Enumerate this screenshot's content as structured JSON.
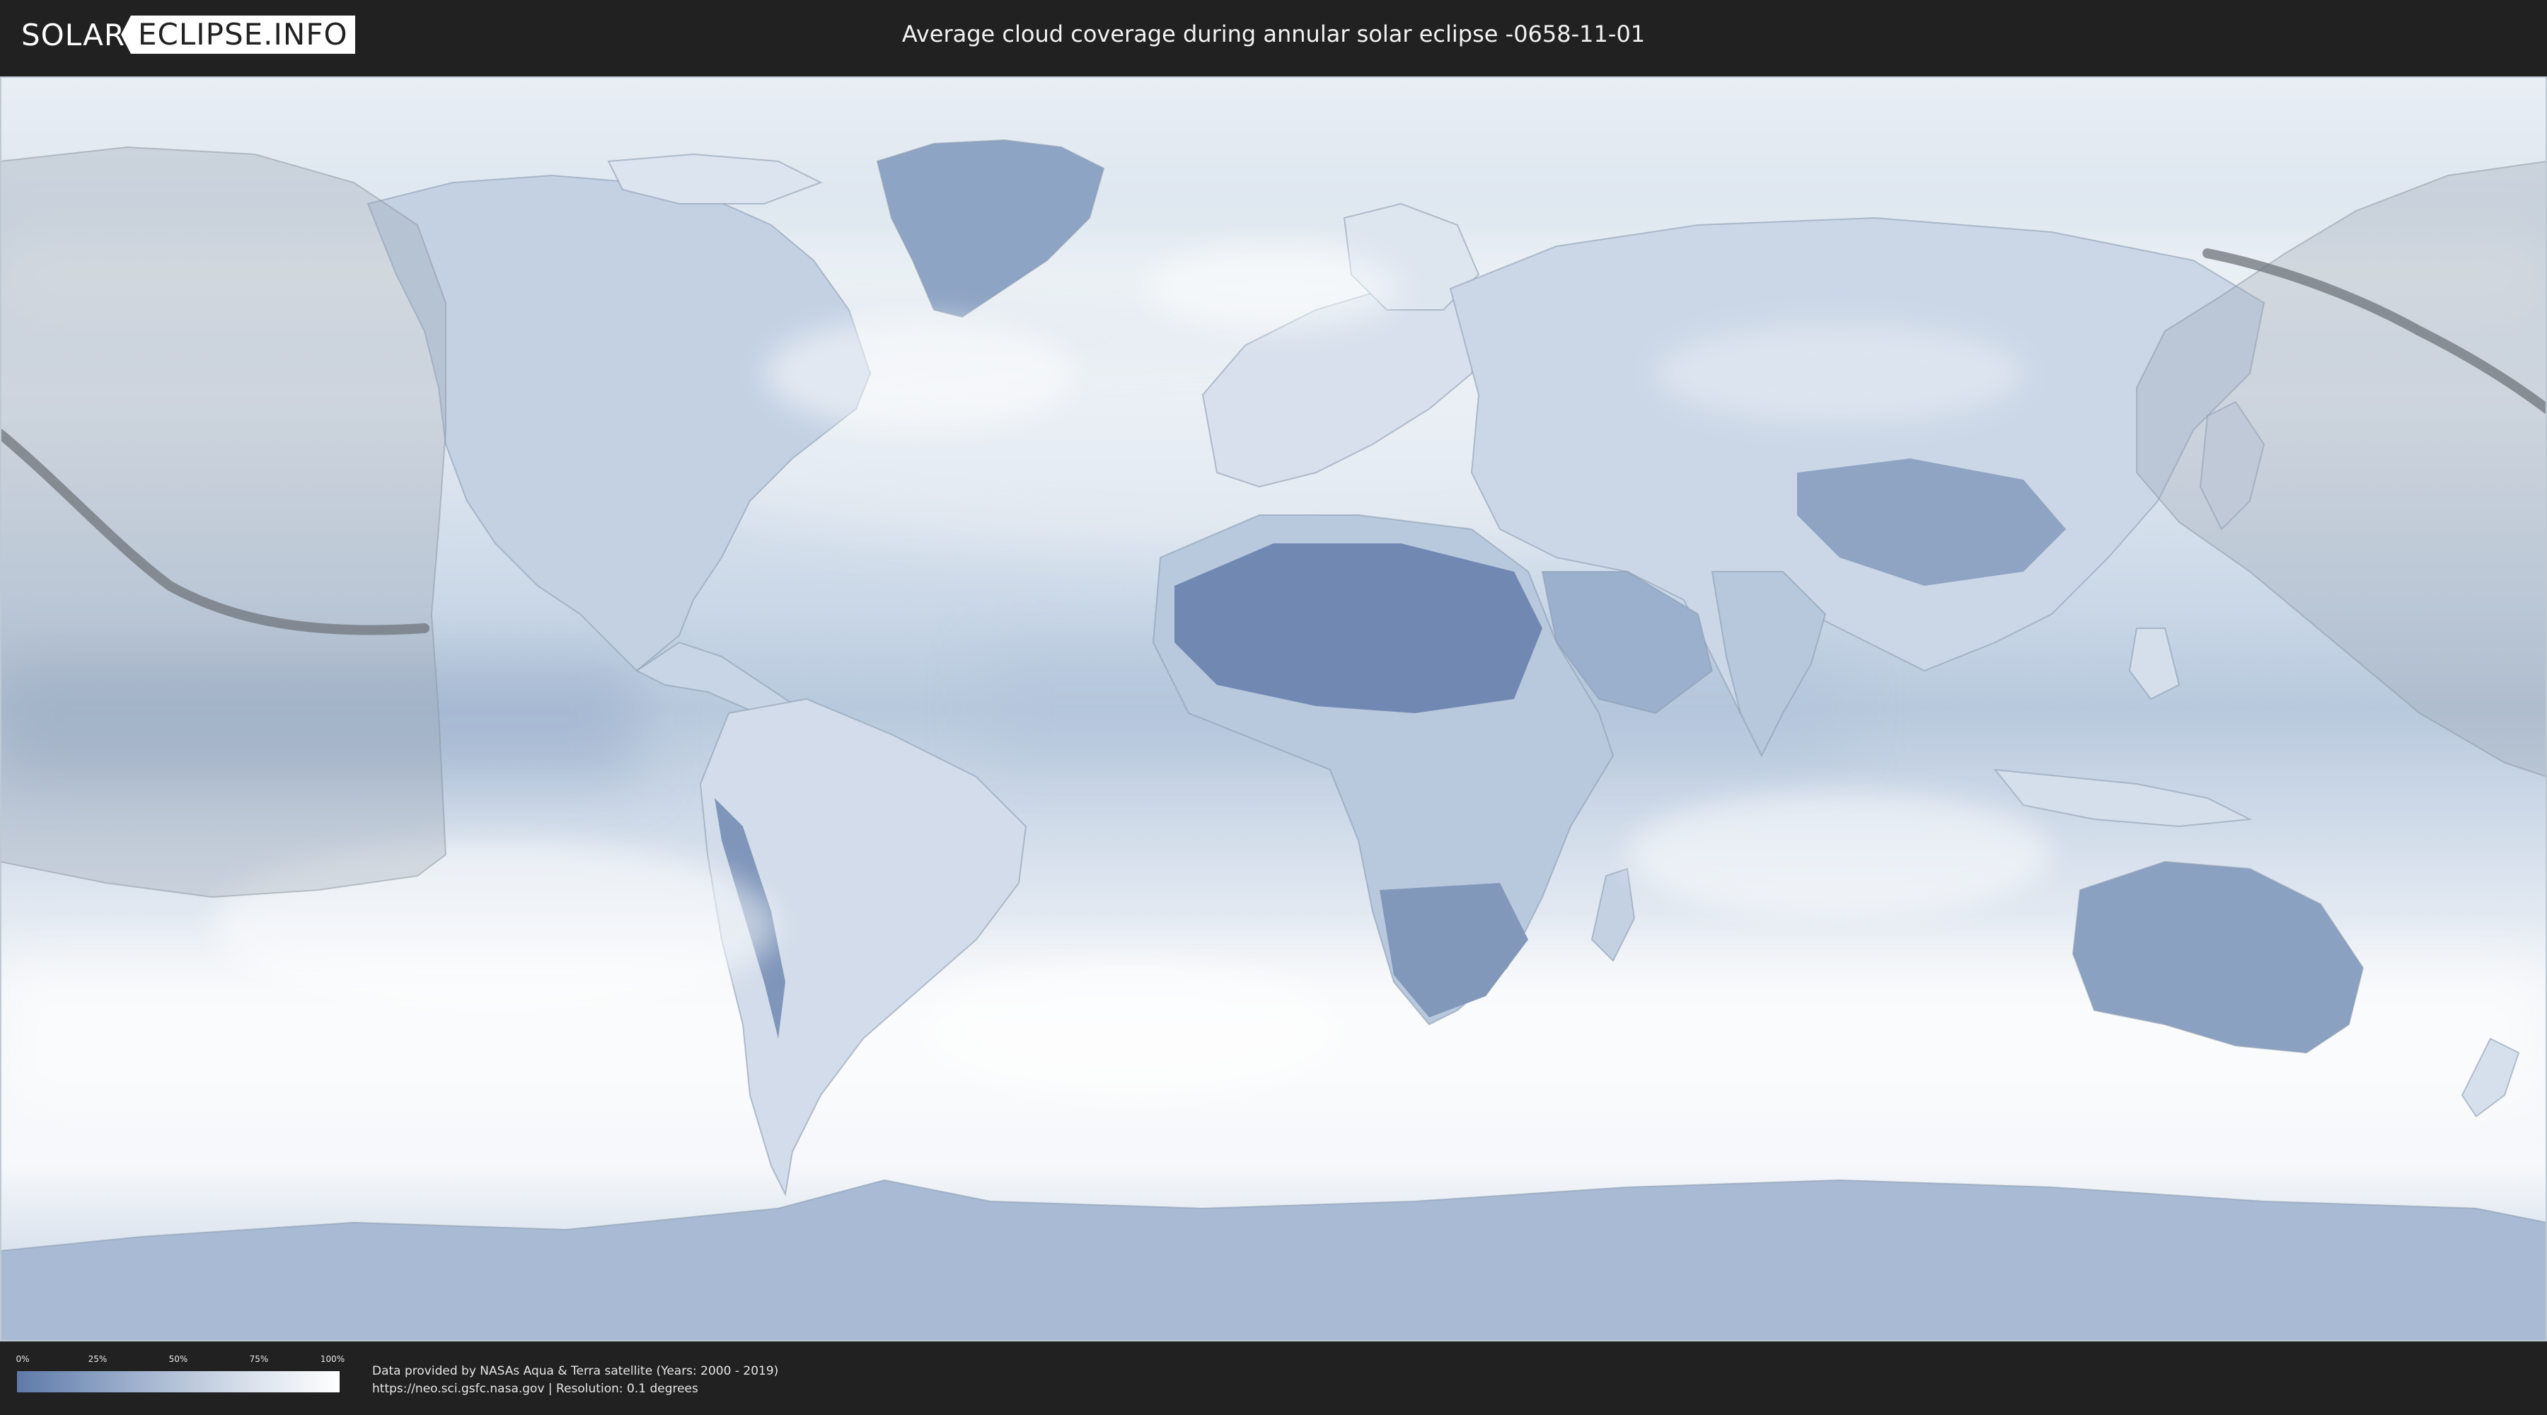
{
  "header": {
    "logo_part1": "SOLAR",
    "logo_part2": "ECLIPSE.INFO",
    "title": "Average cloud coverage during annular solar eclipse -0658-11-01"
  },
  "map": {
    "kind": "equirectangular world map of average cloud coverage",
    "colors": {
      "low_cloud": "#5f7aa8",
      "high_cloud": "#ffffff",
      "eclipse_zone": "#9aa4b0",
      "eclipse_path": "#6f747b"
    }
  },
  "legend": {
    "ticks": [
      "0%",
      "25%",
      "50%",
      "75%",
      "100%"
    ],
    "gradient_colors": [
      "#5f7aa8",
      "#8aa0c3",
      "#b6c4d9",
      "#dde4ee",
      "#ffffff"
    ]
  },
  "footer": {
    "credit_line1": "Data provided by NASAs Aqua & Terra satellite (Years: 2000 - 2019)",
    "credit_line2": "https://neo.sci.gsfc.nasa.gov | Resolution: 0.1 degrees"
  }
}
